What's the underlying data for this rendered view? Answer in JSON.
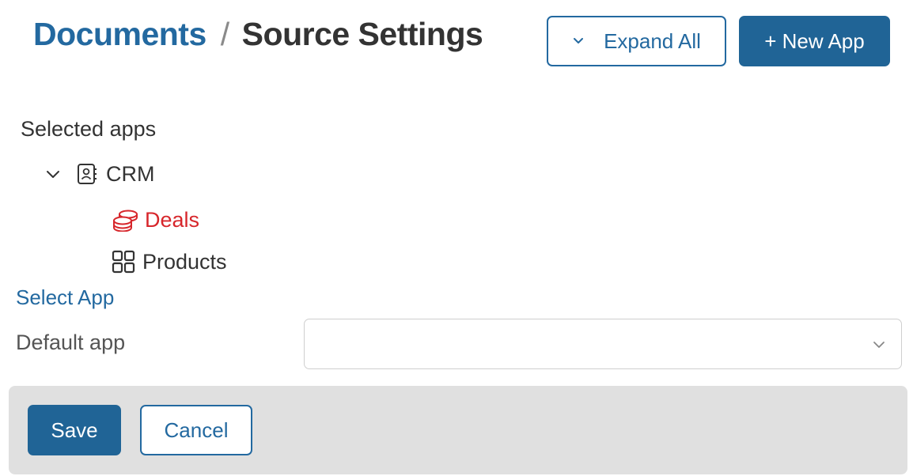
{
  "breadcrumb": {
    "parent": "Documents",
    "separator": "/",
    "current": "Source Settings"
  },
  "toolbar": {
    "expand_all_label": "Expand All",
    "new_app_label": "+ New App"
  },
  "selected_apps": {
    "heading": "Selected apps",
    "groups": [
      {
        "label": "CRM",
        "icon": "contact-book-icon",
        "expanded": true,
        "items": [
          {
            "label": "Deals",
            "icon": "coins-stack-icon",
            "color": "#d7262b"
          },
          {
            "label": "Products",
            "icon": "grid-icon"
          }
        ]
      }
    ]
  },
  "select_app_link": "Select App",
  "default_app": {
    "label": "Default app",
    "value": ""
  },
  "footer": {
    "save_label": "Save",
    "cancel_label": "Cancel"
  },
  "colors": {
    "primary": "#206496",
    "link": "#2369a0",
    "accent_red": "#d7262b",
    "footer_bg": "#e0e0e0"
  }
}
